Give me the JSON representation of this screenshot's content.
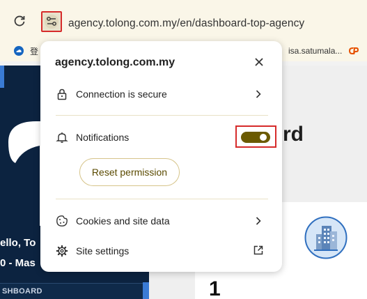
{
  "browser": {
    "url": "agency.tolong.com.my/en/dashboard-top-agency",
    "bookmarks": [
      {
        "label": "登"
      },
      {
        "label": "isa.satumala..."
      }
    ]
  },
  "popup": {
    "domain": "agency.tolong.com.my",
    "connection_label": "Connection is secure",
    "notifications_label": "Notifications",
    "notifications_enabled": true,
    "reset_label": "Reset permission",
    "cookies_label": "Cookies and site data",
    "settings_label": "Site settings"
  },
  "page": {
    "greeting": "ello, To",
    "role": "0 - Mas",
    "nav_section": "SHBOARD",
    "heading_fragment": "rd",
    "stat_value": "1"
  },
  "colors": {
    "toggle_on": "#6b5a00",
    "highlight_box": "#d62b2b",
    "sidebar_bg": "#0c2340"
  }
}
